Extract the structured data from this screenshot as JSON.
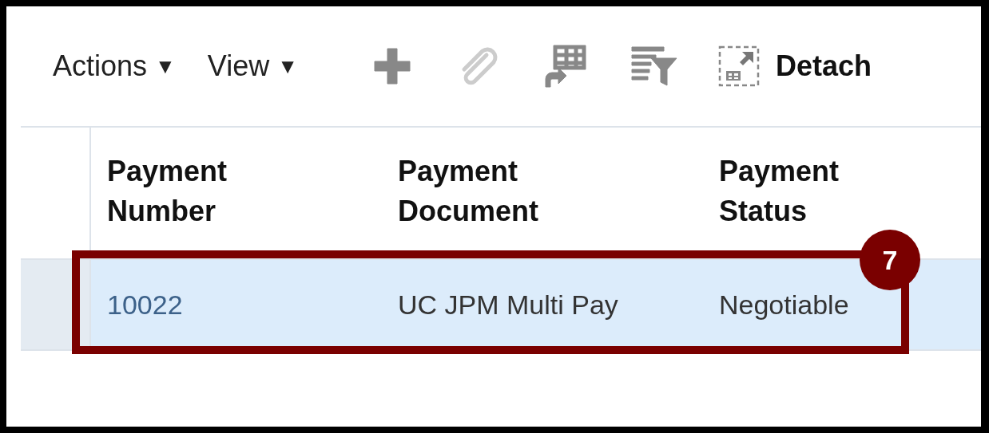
{
  "toolbar": {
    "menus": [
      {
        "label": "Actions",
        "caret": "▼"
      },
      {
        "label": "View",
        "caret": "▼"
      }
    ],
    "icons": [
      {
        "kind": "add",
        "disabled": false
      },
      {
        "kind": "attach",
        "disabled": true
      },
      {
        "kind": "export",
        "disabled": false
      },
      {
        "kind": "filter",
        "disabled": false
      }
    ],
    "detach": {
      "label": "Detach"
    }
  },
  "table": {
    "columns": [
      "Payment Number",
      "Payment Document",
      "Payment Status"
    ],
    "rows": [
      {
        "selected": true,
        "cells": [
          {
            "kind": "link",
            "text": "10022"
          },
          {
            "kind": "text",
            "text": "UC JPM Multi Pay"
          },
          {
            "kind": "text",
            "text": "Negotiable"
          }
        ]
      }
    ]
  },
  "callout": {
    "number": "7"
  }
}
